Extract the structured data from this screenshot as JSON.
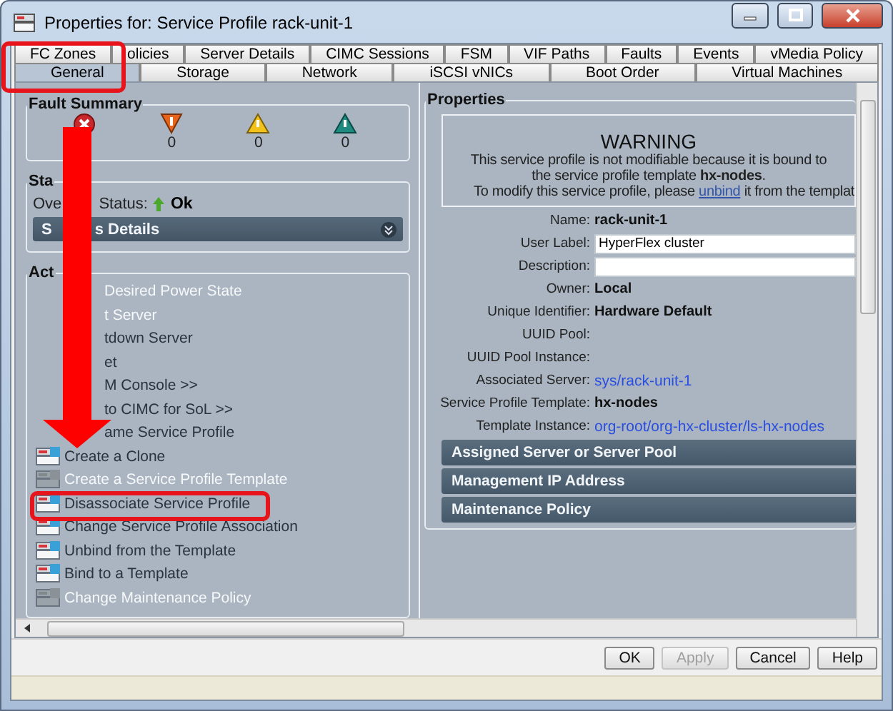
{
  "window": {
    "title": "Properties for: Service Profile rack-unit-1"
  },
  "tab_rows": [
    [
      {
        "label": "FC Zones",
        "selected": false
      },
      {
        "label": "olicies",
        "selected": false
      },
      {
        "label": "Server Details",
        "selected": false
      },
      {
        "label": "CIMC Sessions",
        "selected": false
      },
      {
        "label": "FSM",
        "selected": false
      },
      {
        "label": "VIF Paths",
        "selected": false
      },
      {
        "label": "Faults",
        "selected": false
      },
      {
        "label": "Events",
        "selected": false
      },
      {
        "label": "vMedia Policy",
        "selected": false
      }
    ],
    [
      {
        "label": "General",
        "selected": true
      },
      {
        "label": "Storage",
        "selected": false
      },
      {
        "label": "Network",
        "selected": false
      },
      {
        "label": "iSCSI vNICs",
        "selected": false
      },
      {
        "label": "Boot Order",
        "selected": false
      },
      {
        "label": "Virtual Machines",
        "selected": false
      }
    ]
  ],
  "fault_summary": {
    "title": "Fault Summary",
    "items": [
      {
        "kind": "critical"
      },
      {
        "kind": "major",
        "count": "0"
      },
      {
        "kind": "minor",
        "count": "0"
      },
      {
        "kind": "warning",
        "count": "0"
      }
    ]
  },
  "status": {
    "title": "Sta",
    "label_parts": [
      "Ove",
      "Status:"
    ],
    "value": "Ok",
    "details_parts": [
      "S",
      "s Details"
    ]
  },
  "actions": {
    "title": "Act",
    "items": [
      {
        "label": "Desired Power State",
        "kind": "covered",
        "disabled": true
      },
      {
        "label": "t Server",
        "kind": "covered",
        "disabled": true
      },
      {
        "label": "tdown Server",
        "kind": "covered",
        "disabled": false
      },
      {
        "label": "et",
        "kind": "covered",
        "disabled": false
      },
      {
        "label": "M Console >>",
        "kind": "covered",
        "disabled": false
      },
      {
        "label": "to CIMC for SoL >>",
        "kind": "covered",
        "disabled": false
      },
      {
        "label": "ame Service Profile",
        "kind": "covered",
        "disabled": false
      },
      {
        "label": "Create a Clone",
        "kind": "full",
        "disabled": false
      },
      {
        "label": "Create a Service Profile Template",
        "kind": "full",
        "disabled": true
      },
      {
        "label": "Disassociate Service Profile",
        "kind": "full",
        "disabled": false
      },
      {
        "label": "Change Service Profile Association",
        "kind": "full",
        "disabled": false
      },
      {
        "label": "Unbind from the Template",
        "kind": "full",
        "disabled": false
      },
      {
        "label": "Bind to a Template",
        "kind": "full",
        "disabled": false
      },
      {
        "label": "Change Maintenance Policy",
        "kind": "full",
        "disabled": true
      }
    ]
  },
  "properties": {
    "title": "Properties",
    "warning": {
      "heading": "WARNING",
      "line_1": "This service profile is not modifiable because it is bound to",
      "line_2": "the service profile template **hx-nodes**.",
      "line_3_before": "To modify this service profile, please ",
      "line_3_link": "unbind",
      "line_3_after": " it from the templat"
    },
    "fields": [
      {
        "label": "Name:",
        "kind": "bold",
        "value": "rack-unit-1"
      },
      {
        "label": "User Label:",
        "kind": "input",
        "value": "HyperFlex cluster"
      },
      {
        "label": "Description:",
        "kind": "input"
      },
      {
        "label": "Owner:",
        "kind": "bold",
        "value": "Local"
      },
      {
        "label": "Unique Identifier:",
        "kind": "bold",
        "value": "Hardware Default"
      },
      {
        "label": "UUID Pool:",
        "kind": "blank"
      },
      {
        "label": "UUID Pool Instance:",
        "kind": "blank"
      },
      {
        "label": "Associated Server:",
        "kind": "link",
        "value": "sys/rack-unit-1"
      },
      {
        "label": "Service Profile Template:",
        "kind": "bold",
        "value": "hx-nodes"
      },
      {
        "label": "Template Instance:",
        "kind": "link",
        "value": "org-root/org-hx-cluster/ls-hx-nodes"
      }
    ],
    "sections": [
      "Assigned Server or Server Pool",
      "Management IP Address",
      "Maintenance Policy"
    ]
  },
  "buttons": [
    {
      "label": "OK",
      "disabled": false
    },
    {
      "label": "Apply",
      "disabled": true
    },
    {
      "label": "Cancel",
      "disabled": false
    },
    {
      "label": "Help",
      "disabled": false
    }
  ]
}
